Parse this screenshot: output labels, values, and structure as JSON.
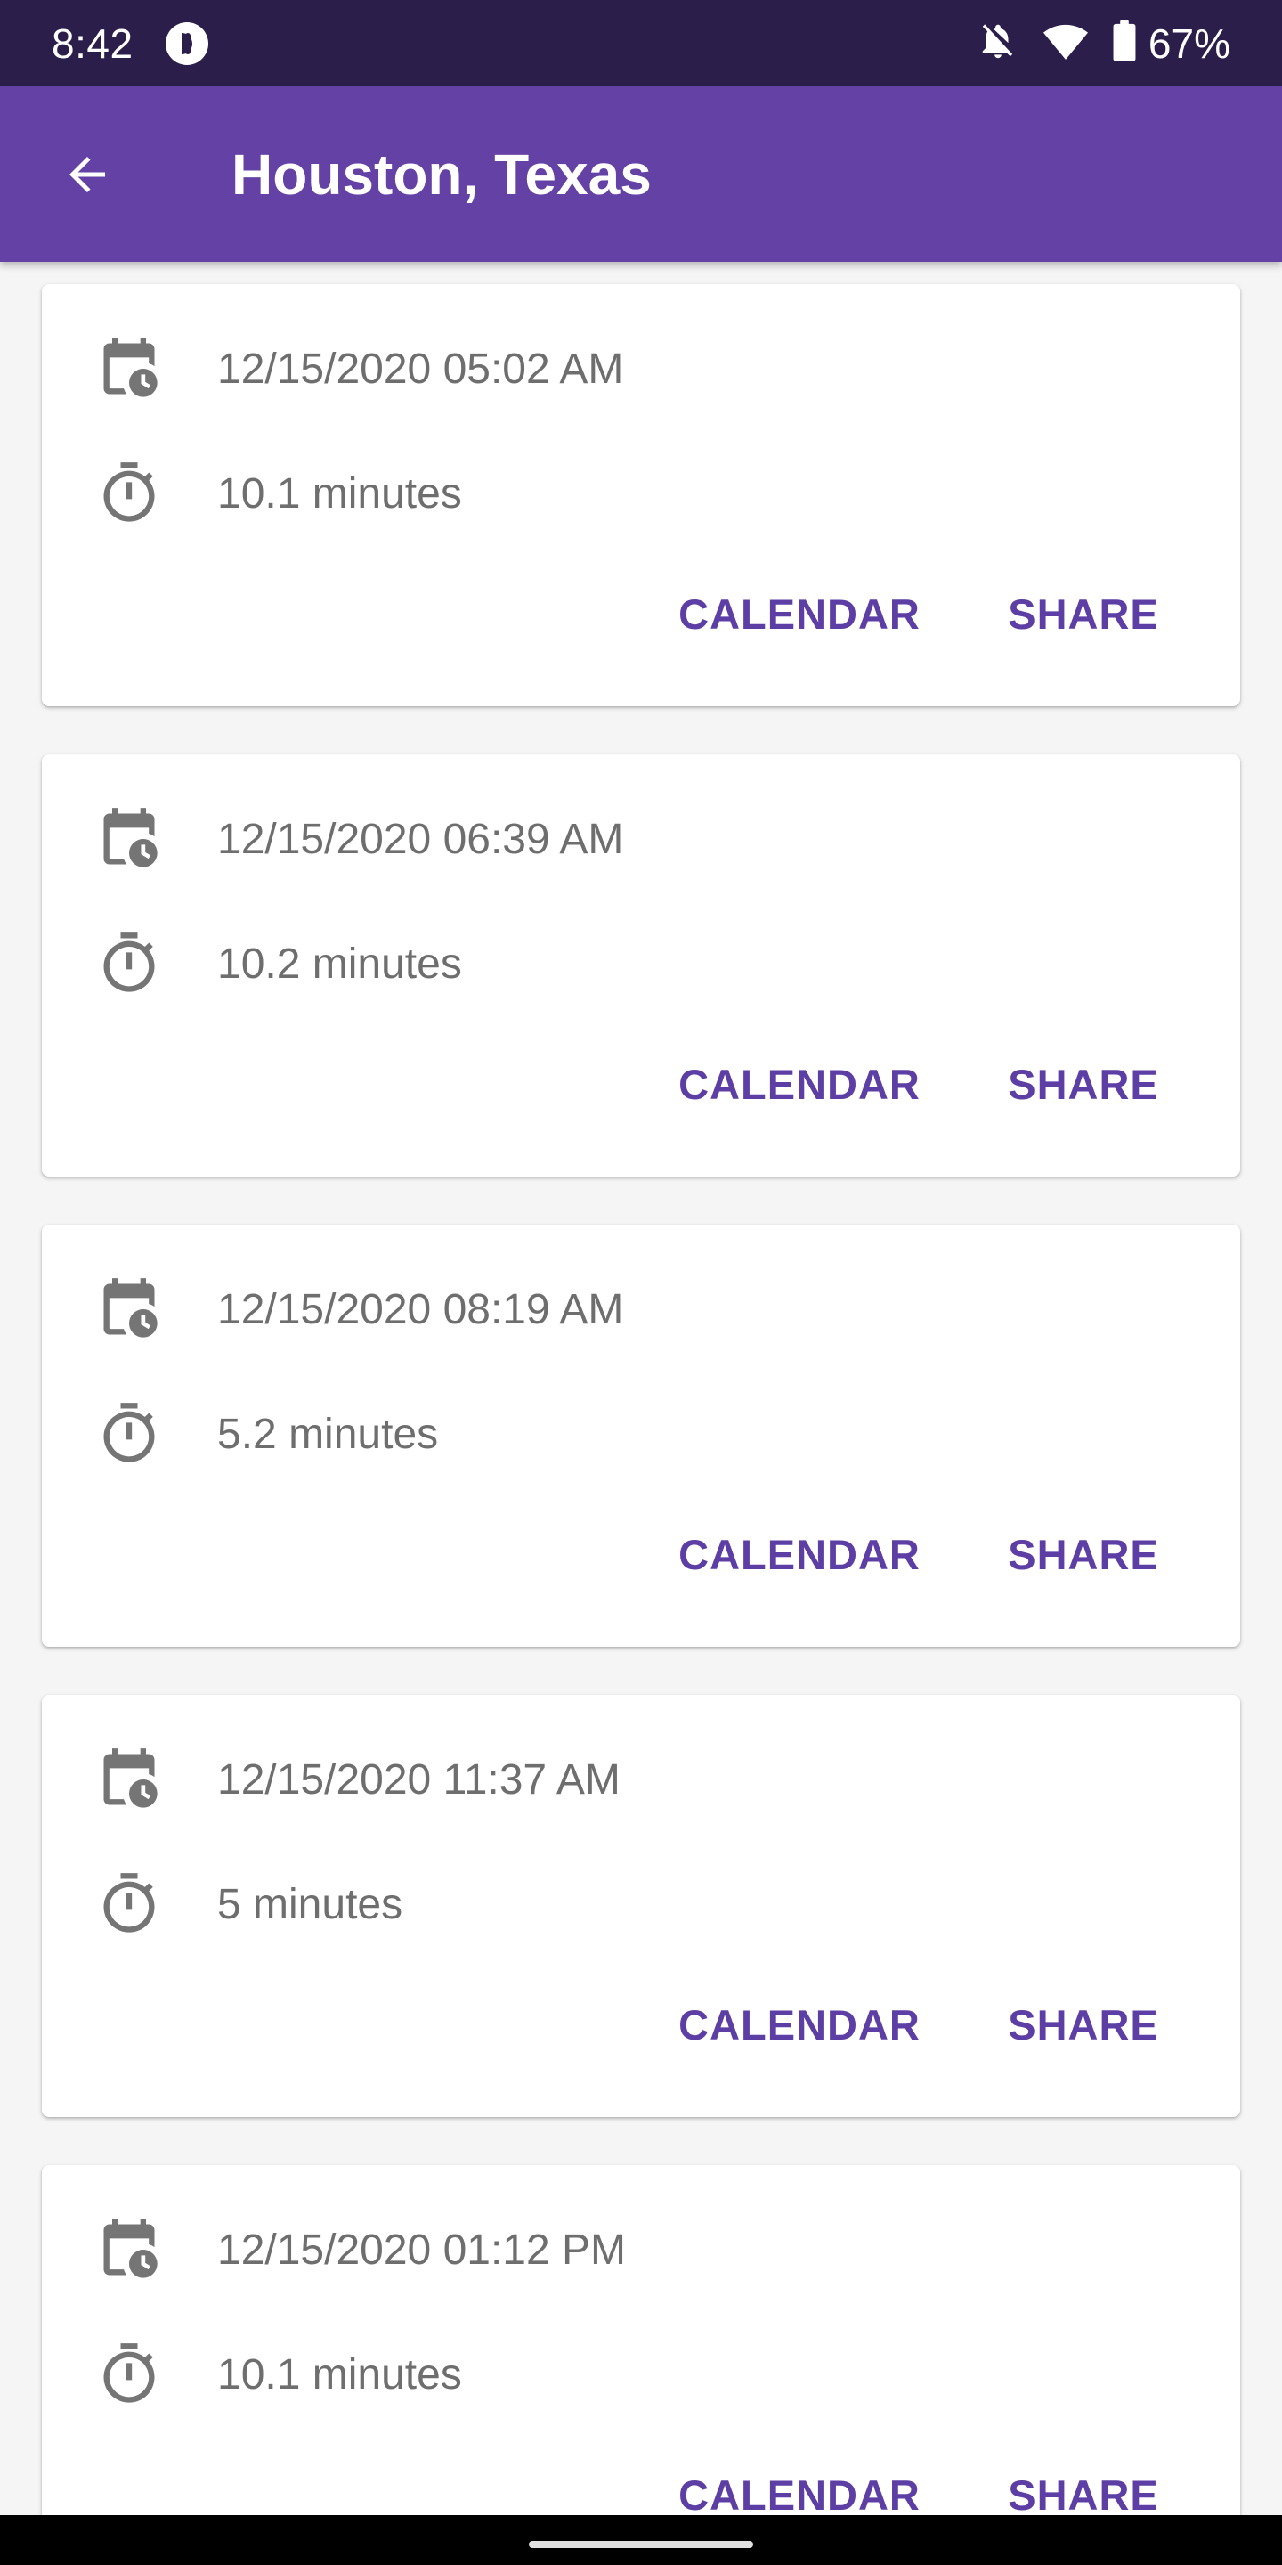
{
  "status_bar": {
    "time": "8:42",
    "battery": "67%",
    "icons": [
      "app-notification-icon",
      "notifications-off-icon",
      "wifi-icon",
      "battery-icon"
    ]
  },
  "app_bar": {
    "title": "Houston, Texas",
    "back_icon": "arrow-left-icon",
    "color": "#6441a5"
  },
  "entries": [
    {
      "date": "12/15/2020 05:02 AM",
      "duration": "10.1 minutes",
      "calendar_label": "CALENDAR",
      "share_label": "SHARE"
    },
    {
      "date": "12/15/2020 06:39 AM",
      "duration": "10.2 minutes",
      "calendar_label": "CALENDAR",
      "share_label": "SHARE"
    },
    {
      "date": "12/15/2020 08:19 AM",
      "duration": "5.2 minutes",
      "calendar_label": "CALENDAR",
      "share_label": "SHARE"
    },
    {
      "date": "12/15/2020 11:37 AM",
      "duration": "5 minutes",
      "calendar_label": "CALENDAR",
      "share_label": "SHARE"
    },
    {
      "date": "12/15/2020 01:12 PM",
      "duration": "10.1 minutes",
      "calendar_label": "CALENDAR",
      "share_label": "SHARE"
    }
  ],
  "colors": {
    "status_bar": "#2c1e4b",
    "accent_text": "#5d3ea4",
    "secondary_text": "#6e6e6e"
  }
}
